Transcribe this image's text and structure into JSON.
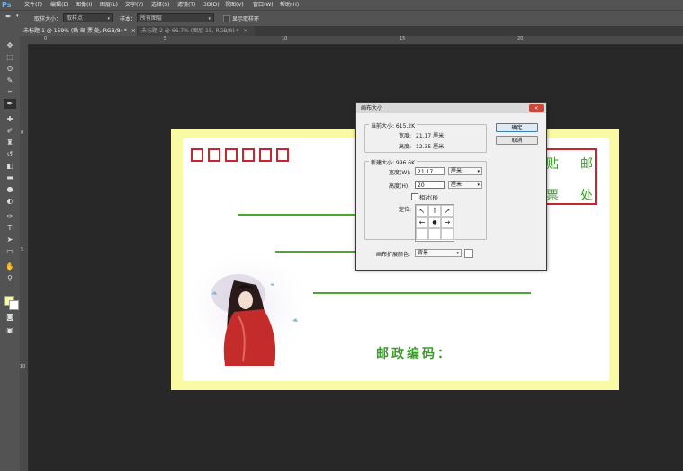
{
  "app": {
    "logo": "Ps",
    "menus": [
      "文件(F)",
      "编辑(E)",
      "图像(I)",
      "图层(L)",
      "文字(Y)",
      "选择(S)",
      "滤镜(T)",
      "3D(D)",
      "视图(V)",
      "窗口(W)",
      "帮助(H)"
    ]
  },
  "options_bar": {
    "sample_size_label": "取样大小：",
    "sample_size_value": "取样点",
    "sample_label": "样本：",
    "sample_value": "所有图层",
    "show_ring_label": "显示取样环"
  },
  "tabs": [
    {
      "label": "未标题-1 @ 159% (贴 邮 票 处, RGB/8) *",
      "close": "×",
      "active": true
    },
    {
      "label": "未标题-2 @ 66.7% (图层 15, RGB/8) *",
      "close": "×",
      "active": false
    }
  ],
  "rulers": {
    "top": [
      "0",
      "5",
      "10",
      "15",
      "20"
    ],
    "left": [
      "0",
      "5",
      "10"
    ]
  },
  "envelope": {
    "zip_boxes": 6,
    "postal_code_label": "邮政编码：",
    "stamp_chars": [
      "贴",
      "邮",
      "票",
      "处"
    ],
    "colors": {
      "border": "#fbfaa4",
      "red": "#c8262f",
      "green": "#3d9a2d"
    }
  },
  "dialog": {
    "title": "画布大小",
    "close": "×",
    "current_size_label": "当前大小: 615.2K",
    "current_width_label": "宽度:",
    "current_width_value": "21.17 厘米",
    "current_height_label": "高度:",
    "current_height_value": "12.35 厘米",
    "new_size_label": "新建大小: 996.6K",
    "width_label": "宽度(W):",
    "width_value": "21.17",
    "width_unit": "厘米",
    "height_label": "高度(H):",
    "height_value": "20",
    "height_unit": "厘米",
    "relative_label": "相对(R)",
    "anchor_label": "定位:",
    "anchor_arrows": [
      "↖",
      "↑",
      "↗",
      "←",
      "●",
      "→",
      "",
      "",
      ""
    ],
    "extension_color_label": "画布扩展颜色:",
    "extension_color_value": "背景",
    "ok_label": "确定",
    "cancel_label": "取消"
  }
}
